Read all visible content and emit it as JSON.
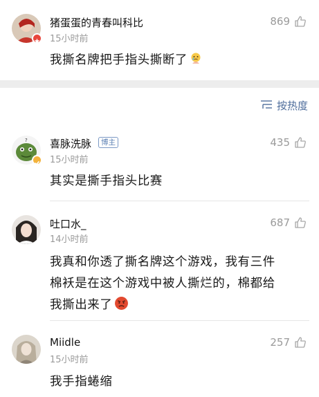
{
  "top_comment": {
    "username": "猪蛋蛋的青春叫科比",
    "time": "15小时前",
    "likes": "869",
    "text": "我撕名牌把手指头撕断了",
    "emoji": "crying-face-emoji",
    "avatar": "avatar-red-hair"
  },
  "sort": {
    "label": "按热度",
    "icon": "sort-lines-icon"
  },
  "comments": [
    {
      "username": "喜脉洗脉",
      "badge": "博主",
      "time": "15小时前",
      "likes": "435",
      "text": "其实是撕手指头比赛",
      "avatar": "avatar-green-frog"
    },
    {
      "username": "吐口水_",
      "time": "14小时前",
      "likes": "687",
      "text_lines": [
        "我真和你透了撕名牌这个游戏，我有三件",
        "棉袄是在这个游戏中被人撕烂的，棉都给",
        "我撕出来了"
      ],
      "emoji": "angry-face-emoji",
      "avatar": "avatar-dark-hair"
    },
    {
      "username": "Miidle",
      "time": "15小时前",
      "likes": "257",
      "text": "我手指蜷缩",
      "avatar": "avatar-light-portrait"
    }
  ],
  "colors": {
    "link_blue": "#4f6e9c",
    "meta_gray": "#9a9a9a",
    "separator": "#ededed"
  }
}
